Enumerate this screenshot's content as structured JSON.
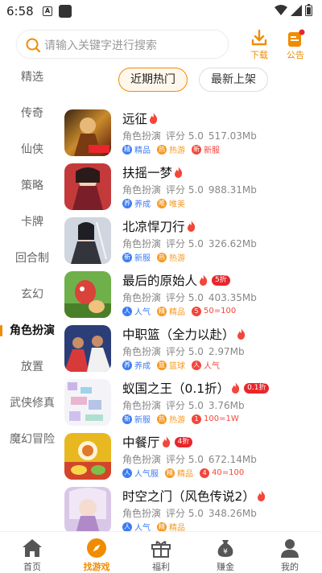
{
  "status": {
    "time": "6:58",
    "a_icon": "A"
  },
  "search": {
    "placeholder": "请输入关键字进行搜索"
  },
  "header": {
    "download_label": "下载",
    "notice_label": "公告"
  },
  "colors": {
    "accent": "#f08c00",
    "blue_tag": "#3b7cf5",
    "orange_tag": "#f59a23",
    "red_tag": "#f2463a",
    "green_tag": "#2cb34a"
  },
  "sidebar": {
    "items": [
      {
        "label": "精选"
      },
      {
        "label": "传奇"
      },
      {
        "label": "仙侠"
      },
      {
        "label": "策略"
      },
      {
        "label": "卡牌"
      },
      {
        "label": "回合制"
      },
      {
        "label": "玄幻"
      },
      {
        "label": "角色扮演"
      },
      {
        "label": "放置"
      },
      {
        "label": "武侠修真"
      },
      {
        "label": "魔幻冒险"
      }
    ],
    "active": "角色扮演"
  },
  "tabs": {
    "hot": "近期热门",
    "new": "最新上架"
  },
  "games": [
    {
      "name": "远征",
      "genre": "角色扮演",
      "rating": "评分 5.0",
      "size": "517.03Mb",
      "badge": "",
      "tags": [
        {
          "icon": "精",
          "label": "精品",
          "color": "#3b7cf5"
        },
        {
          "icon": "热",
          "label": "热游",
          "color": "#f59a23"
        },
        {
          "icon": "新",
          "label": "新服",
          "color": "#f2463a"
        }
      ]
    },
    {
      "name": "扶摇一梦",
      "genre": "角色扮演",
      "rating": "评分 5.0",
      "size": "988.31Mb",
      "badge": "",
      "tags": [
        {
          "icon": "养",
          "label": "养成",
          "color": "#3b7cf5"
        },
        {
          "icon": "唯",
          "label": "唯美",
          "color": "#f59a23"
        }
      ]
    },
    {
      "name": "北凉悍刀行",
      "genre": "角色扮演",
      "rating": "评分 5.0",
      "size": "326.62Mb",
      "badge": "",
      "tags": [
        {
          "icon": "新",
          "label": "新服",
          "color": "#3b7cf5"
        },
        {
          "icon": "热",
          "label": "热游",
          "color": "#f59a23"
        }
      ]
    },
    {
      "name": "最后的原始人",
      "genre": "角色扮演",
      "rating": "评分 5.0",
      "size": "403.35Mb",
      "badge": "5折",
      "tags": [
        {
          "icon": "人",
          "label": "人气",
          "color": "#3b7cf5"
        },
        {
          "icon": "精",
          "label": "精品",
          "color": "#f59a23"
        },
        {
          "icon": "5",
          "label": "50=100",
          "color": "#f2463a"
        }
      ]
    },
    {
      "name": "中职篮（全力以赴）",
      "genre": "角色扮演",
      "rating": "评分 5.0",
      "size": "2.97Mb",
      "badge": "",
      "tags": [
        {
          "icon": "养",
          "label": "养成",
          "color": "#3b7cf5"
        },
        {
          "icon": "篮",
          "label": "篮球",
          "color": "#f59a23"
        },
        {
          "icon": "人",
          "label": "人气",
          "color": "#f2463a"
        }
      ]
    },
    {
      "name": "蚁国之王（0.1折）",
      "genre": "角色扮演",
      "rating": "评分 5.0",
      "size": "3.76Mb",
      "badge": "0.1折",
      "tags": [
        {
          "icon": "新",
          "label": "新服",
          "color": "#3b7cf5"
        },
        {
          "icon": "热",
          "label": "热游",
          "color": "#f59a23"
        },
        {
          "icon": "1",
          "label": "100=1W",
          "color": "#f2463a"
        }
      ]
    },
    {
      "name": "中餐厅",
      "genre": "角色扮演",
      "rating": "评分 5.0",
      "size": "672.14Mb",
      "badge": "4折",
      "tags": [
        {
          "icon": "人",
          "label": "人气服",
          "color": "#3b7cf5"
        },
        {
          "icon": "精",
          "label": "精品",
          "color": "#f59a23"
        },
        {
          "icon": "4",
          "label": "40=100",
          "color": "#f2463a"
        }
      ]
    },
    {
      "name": "时空之门（风色传说2）",
      "genre": "角色扮演",
      "rating": "评分 5.0",
      "size": "348.26Mb",
      "badge": "",
      "tags": [
        {
          "icon": "人",
          "label": "人气",
          "color": "#3b7cf5"
        },
        {
          "icon": "精",
          "label": "精品",
          "color": "#f59a23"
        }
      ]
    }
  ],
  "nav": [
    {
      "label": "首页",
      "icon": "home-icon"
    },
    {
      "label": "找游戏",
      "icon": "compass-icon"
    },
    {
      "label": "福利",
      "icon": "gift-icon"
    },
    {
      "label": "赚金",
      "icon": "money-bag-icon"
    },
    {
      "label": "我的",
      "icon": "user-icon"
    }
  ]
}
